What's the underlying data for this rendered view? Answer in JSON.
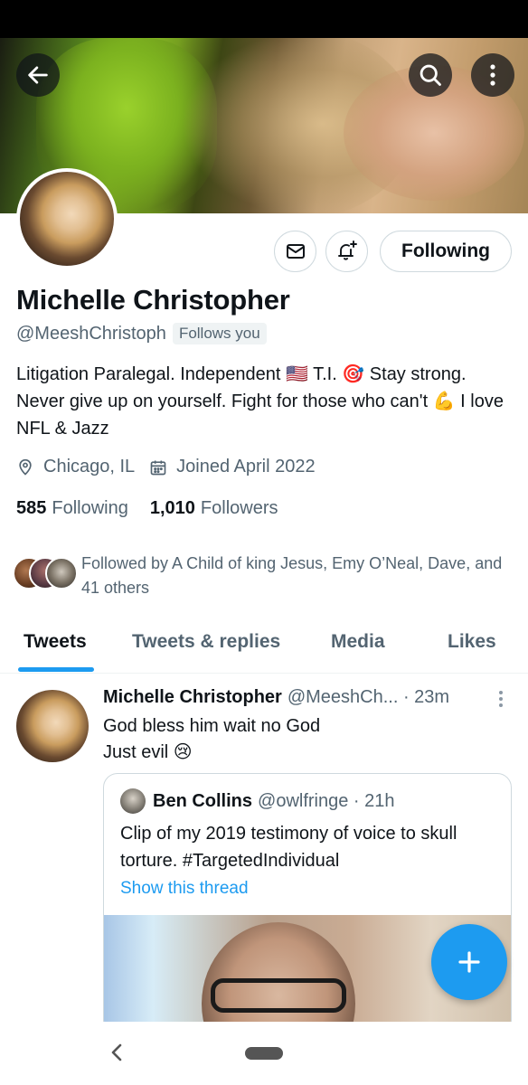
{
  "profile": {
    "name": "Michelle Christopher",
    "handle": "@MeeshChristoph",
    "follows_you": "Follows you",
    "bio": "Litigation Paralegal. Independent 🇺🇸 T.I. 🎯 Stay strong. Never give up on yourself. Fight for those who can't 💪 I love NFL & Jazz",
    "location": "Chicago, IL",
    "joined": "Joined April 2022",
    "following_count": "585",
    "following_label": "Following",
    "followers_count": "1,010",
    "followers_label": "Followers",
    "followed_by": "Followed by A Child of king Jesus, Emy O’Neal, Dave, and 41 others",
    "following_button": "Following"
  },
  "tabs": [
    {
      "label": "Tweets",
      "active": true
    },
    {
      "label": "Tweets & replies",
      "active": false
    },
    {
      "label": "Media",
      "active": false
    },
    {
      "label": "Likes",
      "active": false
    }
  ],
  "tweet": {
    "name": "Michelle Christopher",
    "meta": "@MeeshCh... · 23m",
    "text": "God bless him wait no God\n Just evil 😢",
    "quote": {
      "name": "Ben Collins",
      "meta": "@owlfringe · 21h",
      "text": "Clip of my 2019 testimony of voice to skull torture.  #TargetedIndividual",
      "show_thread": "Show this thread"
    }
  },
  "icons": {
    "back": "arrow-left-icon",
    "search": "search-icon",
    "more": "more-vertical-icon",
    "message": "envelope-icon",
    "notify": "bell-plus-icon",
    "location": "location-pin-icon",
    "calendar": "calendar-icon",
    "compose": "plus-icon"
  },
  "colors": {
    "accent": "#1d9bf0",
    "text_primary": "#0f1419",
    "text_secondary": "#536471"
  }
}
